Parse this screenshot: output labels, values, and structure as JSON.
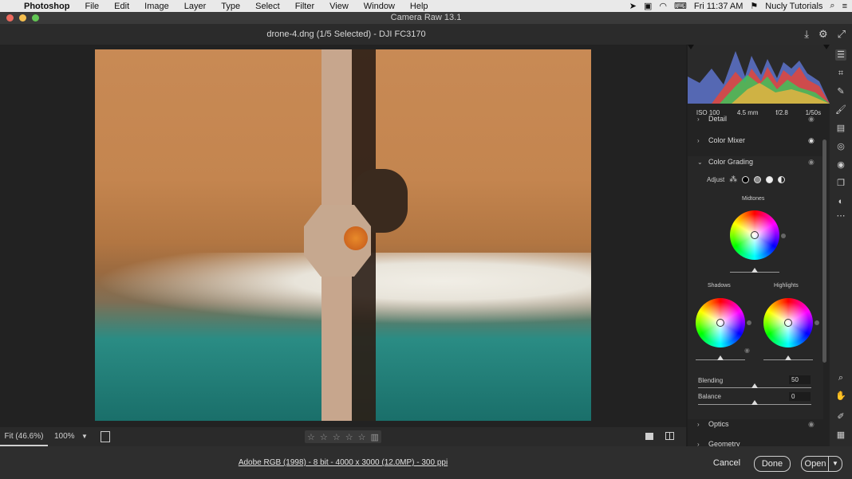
{
  "menubar": {
    "app": "Photoshop",
    "items": [
      "File",
      "Edit",
      "Image",
      "Layer",
      "Type",
      "Select",
      "Filter",
      "View",
      "Window",
      "Help"
    ],
    "clock": "Fri 11:37 AM",
    "user": "Nucly Tutorials"
  },
  "window": {
    "title": "Camera Raw 13.1"
  },
  "header": {
    "filename": "drone-4.dng (1/5 Selected)  -  DJI FC3170"
  },
  "exif": {
    "iso": "ISO 100",
    "focal": "4.5 mm",
    "aperture": "f/2.8",
    "shutter": "1/50s"
  },
  "panel": {
    "detail_label": "Detail",
    "color_mixer_label": "Color Mixer",
    "color_grading_label": "Color Grading",
    "adjust_label": "Adjust",
    "midtones_label": "Midtones",
    "shadows_label": "Shadows",
    "highlights_label": "Highlights",
    "blending_label": "Blending",
    "blending_value": "50",
    "balance_label": "Balance",
    "balance_value": "0",
    "optics_label": "Optics",
    "geometry_label": "Geometry"
  },
  "bottom": {
    "fit": "Fit (46.6%)",
    "zoom": "100%",
    "stars": [
      "☆",
      "☆",
      "☆",
      "☆",
      "☆"
    ]
  },
  "footer": {
    "info": "Adobe RGB (1998) - 8 bit - 4000 x 3000 (12.0MP) - 300 ppi",
    "cancel": "Cancel",
    "done": "Done",
    "open": "Open"
  },
  "colors": {
    "accent": "#cfcfcf",
    "panel_bg": "#232323",
    "canvas_bg": "#222222"
  }
}
